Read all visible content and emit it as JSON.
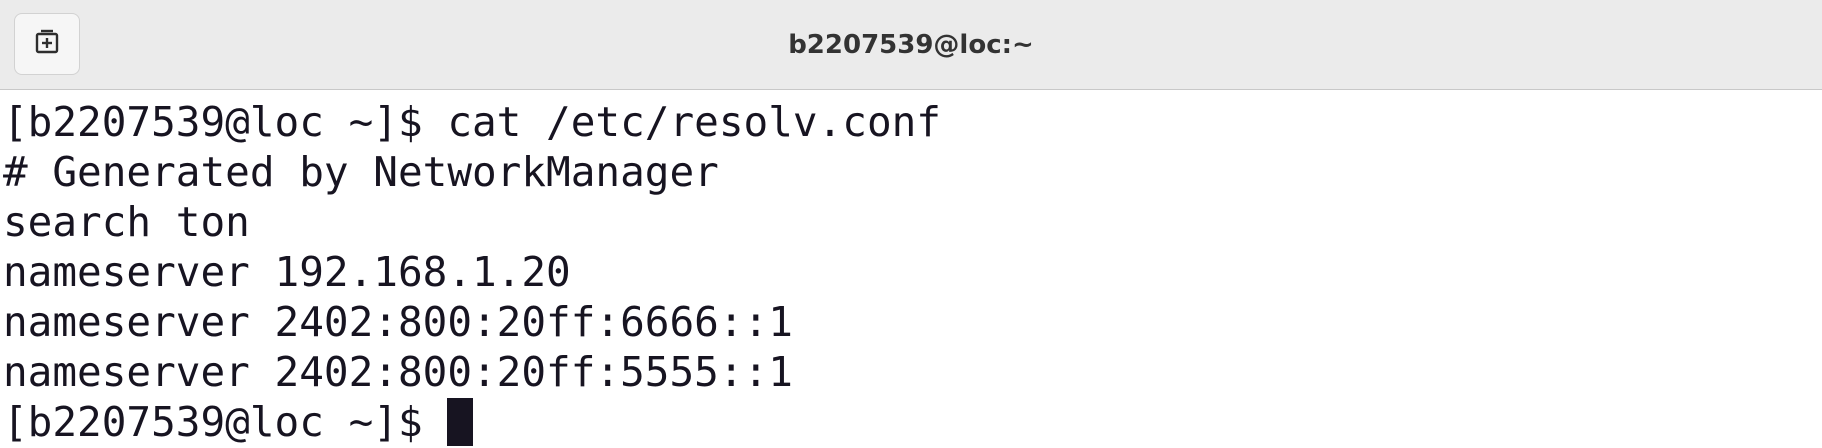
{
  "window": {
    "title": "b2207539@loc:~"
  },
  "titlebar": {
    "new_tab_icon": "new-tab-icon"
  },
  "terminal": {
    "lines": [
      "[b2207539@loc ~]$ cat /etc/resolv.conf",
      "# Generated by NetworkManager",
      "search ton",
      "nameserver 192.168.1.20",
      "nameserver 2402:800:20ff:6666::1",
      "nameserver 2402:800:20ff:5555::1"
    ],
    "prompt": "[b2207539@loc ~]$ "
  },
  "colors": {
    "titlebar_bg": "#ebebeb",
    "terminal_bg": "#ffffff",
    "terminal_fg": "#171421"
  }
}
